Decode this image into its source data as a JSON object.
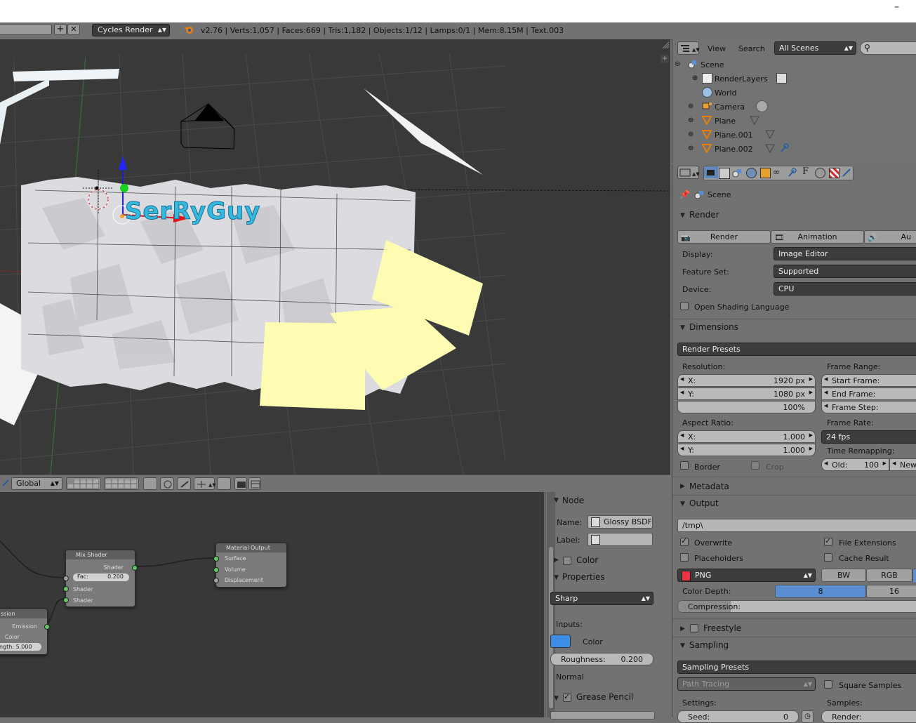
{
  "titlebar": {
    "minimize": "–"
  },
  "info_header": {
    "engine": "Cycles Render",
    "stats": "v2.76 | Verts:1,057 | Faces:669 | Tris:1,182 | Objects:1/12 | Lamps:0/1 | Mem:8.15M | Text.003"
  },
  "viewport": {
    "text_object": "SerRyGuy",
    "toolbar": {
      "orientation": "Global"
    }
  },
  "outliner": {
    "menu_view": "View",
    "menu_search": "Search",
    "scenes_select": "All Scenes",
    "items": [
      {
        "label": "Scene",
        "icon": "scene-icon"
      },
      {
        "label": "RenderLayers",
        "icon": "renderlayers-icon"
      },
      {
        "label": "World",
        "icon": "world-icon"
      },
      {
        "label": "Camera",
        "icon": "camera-icon"
      },
      {
        "label": "Plane",
        "icon": "mesh-icon"
      },
      {
        "label": "Plane.001",
        "icon": "mesh-icon"
      },
      {
        "label": "Plane.002",
        "icon": "mesh-icon"
      }
    ]
  },
  "properties": {
    "context": "Scene",
    "render": {
      "header": "Render",
      "btn_render": "Render",
      "btn_animation": "Animation",
      "btn_audio": "Au",
      "display_label": "Display:",
      "display_value": "Image Editor",
      "feature_label": "Feature Set:",
      "feature_value": "Supported",
      "device_label": "Device:",
      "device_value": "CPU",
      "osl_label": "Open Shading Language"
    },
    "dimensions": {
      "header": "Dimensions",
      "presets": "Render Presets",
      "resolution_label": "Resolution:",
      "res_x_label": "X:",
      "res_x": "1920 px",
      "res_y_label": "Y:",
      "res_y": "1080 px",
      "res_pct": "100%",
      "frame_range_label": "Frame Range:",
      "start_frame": "Start Frame:",
      "end_frame": "End Frame:",
      "frame_step": "Frame Step:",
      "aspect_label": "Aspect Ratio:",
      "asp_x_label": "X:",
      "asp_x": "1.000",
      "asp_y_label": "Y:",
      "asp_y": "1.000",
      "frame_rate_label": "Frame Rate:",
      "frame_rate": "24 fps",
      "time_remap_label": "Time Remapping:",
      "old_label": "Old:",
      "old_value": "100",
      "new_label": "New",
      "border_label": "Border",
      "crop_label": "Crop"
    },
    "metadata": {
      "header": "Metadata"
    },
    "output": {
      "header": "Output",
      "path": "/tmp\\",
      "overwrite": "Overwrite",
      "file_extensions": "File Extensions",
      "placeholders": "Placeholders",
      "cache_result": "Cache Result",
      "format": "PNG",
      "bw": "BW",
      "rgb": "RGB",
      "color_depth_label": "Color Depth:",
      "depth_8": "8",
      "depth_16": "16",
      "compression_label": "Compression:"
    },
    "freestyle": {
      "header": "Freestyle"
    },
    "sampling": {
      "header": "Sampling",
      "presets": "Sampling Presets",
      "integrator": "Path Tracing",
      "square_samples": "Square Samples",
      "settings_label": "Settings:",
      "samples_label": "Samples:",
      "seed_label": "Seed:",
      "seed_value": "0",
      "render_label": "Render:"
    }
  },
  "node_editor": {
    "mix_shader": {
      "title": "Mix Shader",
      "out_shader": "Shader",
      "fac_label": "Fac:",
      "fac_value": "0.200",
      "in_shader1": "Shader",
      "in_shader2": "Shader"
    },
    "material_output": {
      "title": "Material Output",
      "surface": "Surface",
      "volume": "Volume",
      "displacement": "Displacement"
    },
    "emission": {
      "title": "ssion",
      "out": "Emission",
      "color": "Color",
      "strength": "ngth: 5.000"
    }
  },
  "node_panel": {
    "node_header": "Node",
    "name_label": "Name:",
    "name_value": "Glossy BSDF",
    "label_label": "Label:",
    "color_header": "Color",
    "properties_header": "Properties",
    "distribution": "Sharp",
    "inputs_label": "Inputs:",
    "color_label": "Color",
    "color_swatch": "#3d8fe6",
    "roughness_label": "Roughness:",
    "roughness_value": "0.200",
    "normal_label": "Normal",
    "grease_pencil_header": "Grease Pencil"
  }
}
